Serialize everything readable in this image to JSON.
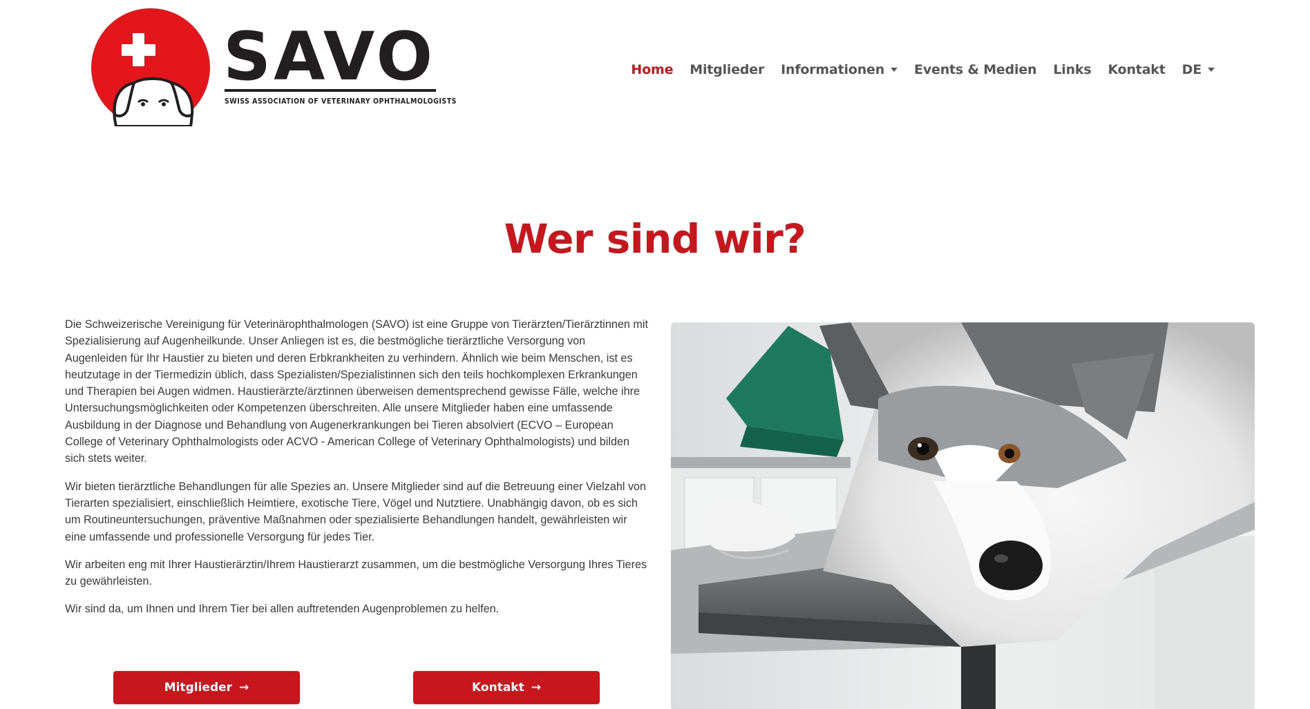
{
  "brand": {
    "name": "SAVO",
    "tagline": "SWISS ASSOCIATION OF VETERINARY OPHTHALMOLOGISTS",
    "colors": {
      "red": "#c8161d",
      "dark": "#231f20"
    }
  },
  "nav": {
    "items": [
      {
        "label": "Home",
        "active": true,
        "dropdown": false
      },
      {
        "label": "Mitglieder",
        "active": false,
        "dropdown": false
      },
      {
        "label": "Informationen",
        "active": false,
        "dropdown": true
      },
      {
        "label": "Events & Medien",
        "active": false,
        "dropdown": false
      },
      {
        "label": "Links",
        "active": false,
        "dropdown": false
      },
      {
        "label": "Kontakt",
        "active": false,
        "dropdown": false
      },
      {
        "label": "DE",
        "active": false,
        "dropdown": true
      }
    ]
  },
  "main": {
    "title": "Wer sind wir?",
    "paragraphs": [
      "Die Schweizerische Vereinigung für Veterinärophthalmologen (SAVO) ist eine Gruppe von Tierärzten/Tierärztinnen mit Spezialisierung auf Augenheilkunde. Unser Anliegen ist es, die bestmögliche tierärztliche Versorgung von Augenleiden für Ihr Haustier zu bieten und deren Erbkrankheiten zu verhindern. Ähnlich wie beim Menschen, ist es heutzutage in der Tiermedizin üblich, dass Spezialisten/Spezialistinnen sich den teils hochkomplexen Erkrankungen und Therapien bei Augen widmen. Haustierärzte/ärztinnen überweisen dementsprechend gewisse Fälle, welche ihre Untersuchungsmöglichkeiten oder Kompetenzen überschreiten. Alle unsere Mitglieder haben eine umfassende Ausbildung in der Diagnose und Behandlung von Augenerkrankungen bei Tieren absolviert (ECVO – European College of Veterinary Ophthalmologists oder ACVO - American College of Veterinary Ophthalmologists) und bilden sich stets weiter.",
      "Wir bieten tierärztliche Behandlungen für alle Spezies an. Unsere Mitglieder sind auf die Betreuung einer Vielzahl von Tierarten spezialisiert, einschließlich Heimtiere, exotische Tiere, Vögel und Nutztiere. Unabhängig davon, ob es sich um Routineuntersuchungen, präventive Maßnahmen oder spezialisierte Behandlungen handelt, gewährleisten wir eine umfassende und professionelle Versorgung für jedes Tier.",
      "Wir arbeiten eng mit Ihrer Haustierärztin/Ihrem Haustierarzt zusammen, um die bestmögliche Versorgung Ihres Tieres zu gewährleisten.",
      "Wir sind da, um Ihnen und Ihrem Tier bei allen auftretenden Augenproblemen zu helfen."
    ],
    "buttons": {
      "members": "Mitglieder",
      "contact": "Kontakt",
      "arrow": "→"
    }
  }
}
